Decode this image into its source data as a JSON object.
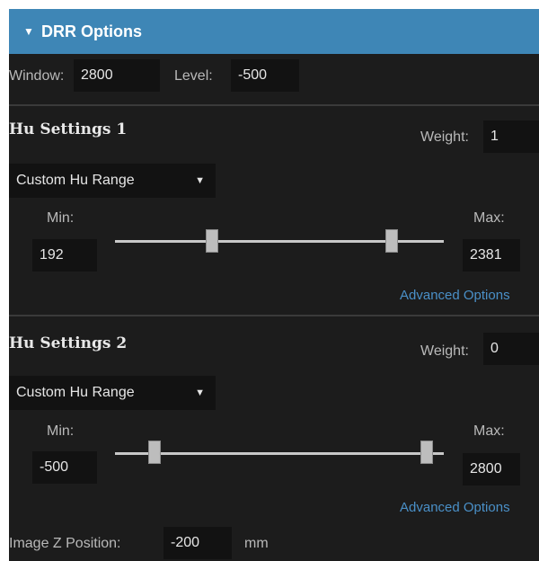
{
  "panel": {
    "title": "DRR Options",
    "caret": "▼"
  },
  "window_level": {
    "window_label": "Window:",
    "window_value": "2800",
    "level_label": "Level:",
    "level_value": "-500"
  },
  "hu1": {
    "title": "Hu Settings 1",
    "weight_label": "Weight:",
    "weight_value": "1",
    "range_mode": "Custom Hu Range",
    "min_label": "Min:",
    "min_value": "192",
    "max_label": "Max:",
    "max_value": "2381",
    "advanced_label": "Advanced Options"
  },
  "hu2": {
    "title": "Hu Settings 2",
    "weight_label": "Weight:",
    "weight_value": "0",
    "range_mode": "Custom Hu Range",
    "min_label": "Min:",
    "min_value": "-500",
    "max_label": "Max:",
    "max_value": "2800",
    "advanced_label": "Advanced Options"
  },
  "image_z": {
    "label": "Image Z Position:",
    "value": "-200",
    "unit": "mm"
  },
  "dropdown_arrow": "▼",
  "colors": {
    "header": "#3e86b6",
    "panel_bg": "#1c1c1c",
    "link": "#4a90c8"
  }
}
